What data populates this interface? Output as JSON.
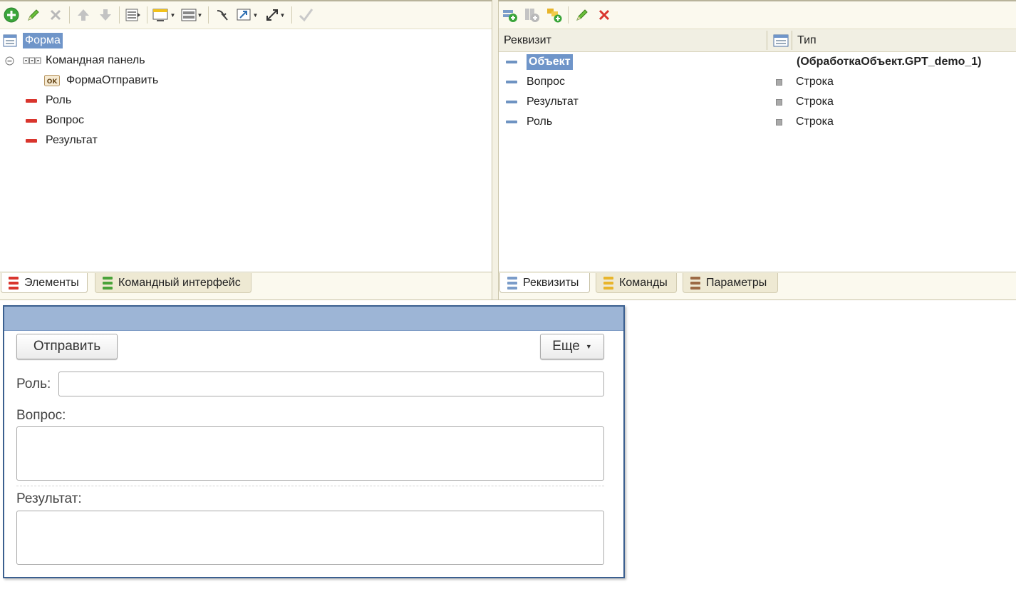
{
  "elements_panel": {
    "tree": [
      {
        "label": "Форма",
        "icon": "form-icon",
        "selected": true
      },
      {
        "label": "Командная панель",
        "icon": "command-panel-icon"
      },
      {
        "label": "ФормаОтправить",
        "icon": "ok-button-icon"
      },
      {
        "label": "Роль",
        "icon": "field-icon"
      },
      {
        "label": "Вопрос",
        "icon": "field-icon"
      },
      {
        "label": "Результат",
        "icon": "field-icon"
      }
    ],
    "tabs": [
      {
        "label": "Элементы",
        "active": true
      },
      {
        "label": "Командный интерфейс",
        "active": false
      }
    ]
  },
  "attributes_panel": {
    "columns": {
      "name": "Реквизит",
      "type": "Тип"
    },
    "rows": [
      {
        "name": "Объект",
        "type": "(ОбработкаОбъект.GPT_demo_1)",
        "selected": true
      },
      {
        "name": "Вопрос",
        "type": "Строка"
      },
      {
        "name": "Результат",
        "type": "Строка"
      },
      {
        "name": "Роль",
        "type": "Строка"
      }
    ],
    "tabs": [
      {
        "label": "Реквизиты",
        "active": true
      },
      {
        "label": "Команды",
        "active": false
      },
      {
        "label": "Параметры",
        "active": false
      }
    ]
  },
  "form_preview": {
    "send_button": "Отправить",
    "more_button": "Еще",
    "role_label": "Роль:",
    "question_label": "Вопрос:",
    "result_label": "Результат:",
    "role_value": "",
    "question_value": "",
    "result_value": ""
  },
  "colors": {
    "selection": "#6f95c9",
    "form_title_bar": "#9db5d6",
    "form_border": "#3b5f8f",
    "panel_background": "#fbf9ee",
    "field_icon_red": "#d9352d",
    "attribute_icon_blue": "#6e93c2"
  }
}
